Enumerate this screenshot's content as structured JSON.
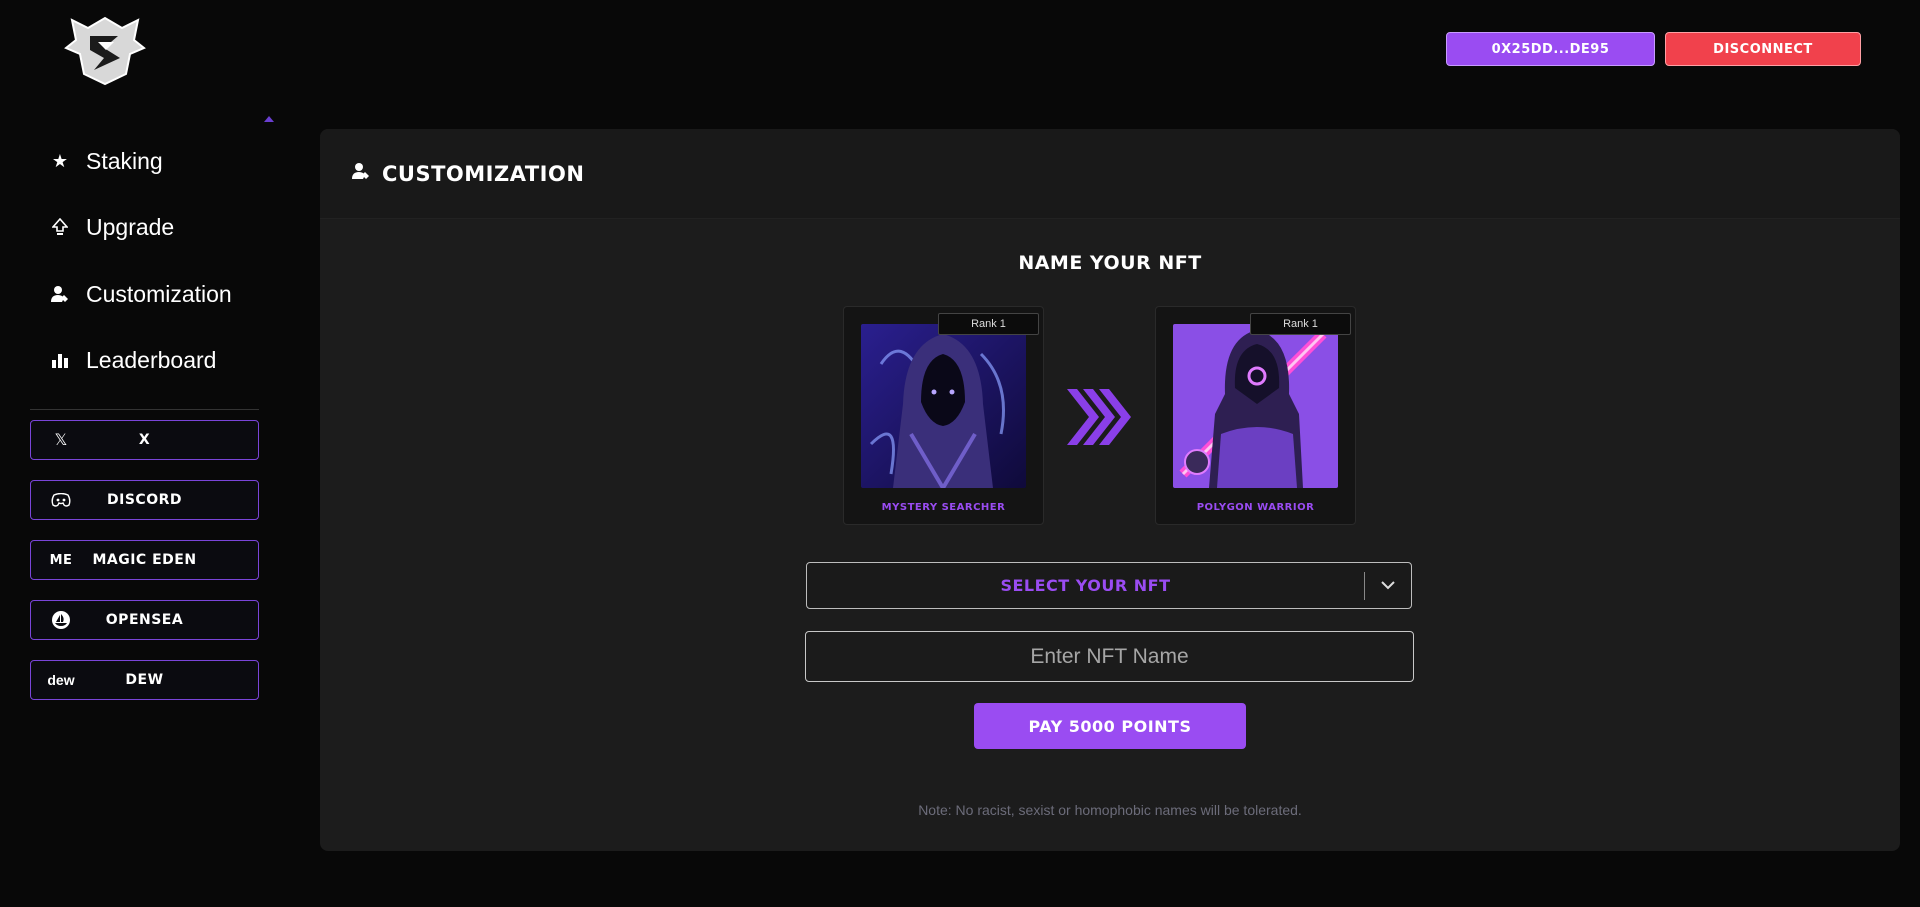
{
  "logo": {
    "icon": "dragon-shield-logo"
  },
  "header": {
    "wallet_label": "0X25DD...DE95",
    "disconnect_label": "DISCONNECT"
  },
  "sidebar": {
    "items": [
      {
        "label": "Staking",
        "icon": "star-icon"
      },
      {
        "label": "Upgrade",
        "icon": "upgrade-arrow-icon"
      },
      {
        "label": "Customization",
        "icon": "user-edit-icon"
      },
      {
        "label": "Leaderboard",
        "icon": "bar-chart-icon"
      }
    ],
    "socials": [
      {
        "label": "X",
        "icon": "x-logo-icon",
        "icon_text": "𝕏"
      },
      {
        "label": "DISCORD",
        "icon": "discord-icon",
        "icon_text": ""
      },
      {
        "label": "MAGIC EDEN",
        "icon": "magic-eden-icon",
        "icon_text": "ME"
      },
      {
        "label": "OPENSEA",
        "icon": "opensea-icon",
        "icon_text": ""
      },
      {
        "label": "DEW",
        "icon": "dew-icon",
        "icon_text": "dew"
      }
    ]
  },
  "main": {
    "title": "CUSTOMIZATION",
    "section_title": "NAME YOUR NFT",
    "cards": [
      {
        "rank": "Rank 1",
        "name": "MYSTERY SEARCHER"
      },
      {
        "rank": "Rank 1",
        "name": "POLYGON WARRIOR"
      }
    ],
    "select": {
      "value": "SELECT YOUR NFT"
    },
    "name_input": {
      "placeholder": "Enter NFT Name",
      "value": ""
    },
    "pay_label": "PAY 5000 POINTS",
    "note": "Note: No racist, sexist or homophobic names will be tolerated."
  },
  "colors": {
    "accent": "#9a4cf2",
    "danger": "#f1414c",
    "background": "#080808",
    "panel": "#1c1c1c"
  }
}
